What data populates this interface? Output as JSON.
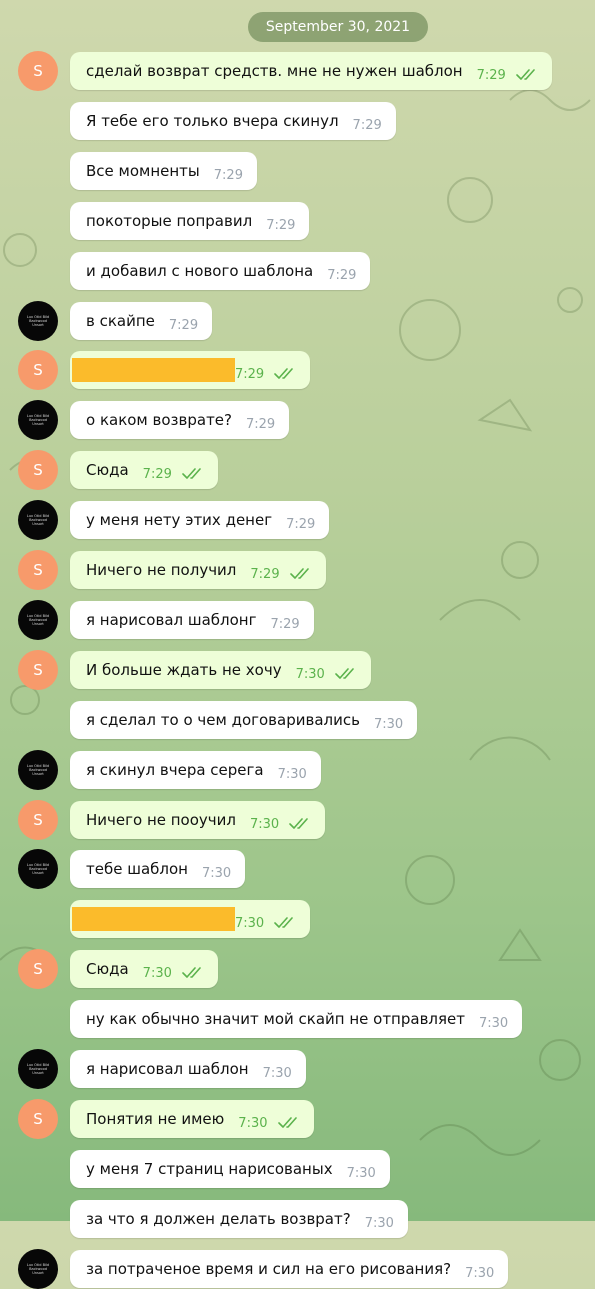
{
  "date_label": "September 30, 2021",
  "colors": {
    "accent_check": "#5bb24c",
    "out_bubble": "#eefed8",
    "in_bubble": "#ffffff",
    "avatar_s": "#f79a6b",
    "avatar_dark": "#070707",
    "highlight": "#fbbb2b"
  },
  "avatar_s_label": "S",
  "avatar_dark_label": "Lux Otid Bild Backwood Unsort",
  "messages": [
    {
      "dir": "out",
      "text": "сделай возврат средств. мне не нужен шаблон",
      "time": "7:29",
      "avatar": "s"
    },
    {
      "dir": "in",
      "text": "Я тебе его только вчера скинул",
      "time": "7:29",
      "avatar": ""
    },
    {
      "dir": "in",
      "text": "Все момненты",
      "time": "7:29",
      "avatar": ""
    },
    {
      "dir": "in",
      "text": "покоторые поправил",
      "time": "7:29",
      "avatar": ""
    },
    {
      "dir": "in",
      "text": "и добавил с нового шаблона",
      "time": "7:29",
      "avatar": ""
    },
    {
      "dir": "in",
      "text": "в скайпе",
      "time": "7:29",
      "avatar": "d"
    },
    {
      "dir": "out",
      "text": "",
      "time": "7:29",
      "avatar": "s",
      "highlight": true
    },
    {
      "dir": "in",
      "text": "о каком возврате?",
      "time": "7:29",
      "avatar": "d"
    },
    {
      "dir": "out",
      "text": "Сюда",
      "time": "7:29",
      "avatar": "s"
    },
    {
      "dir": "in",
      "text": "у меня нету этих денег",
      "time": "7:29",
      "avatar": "d"
    },
    {
      "dir": "out",
      "text": "Ничего не получил",
      "time": "7:29",
      "avatar": "s"
    },
    {
      "dir": "in",
      "text": "я нарисовал шаблонг",
      "time": "7:29",
      "avatar": "d"
    },
    {
      "dir": "out",
      "text": "И больше ждать не хочу",
      "time": "7:30",
      "avatar": "s"
    },
    {
      "dir": "in",
      "text": "я сделал то о чем договаривались",
      "time": "7:30",
      "avatar": ""
    },
    {
      "dir": "in",
      "text": "я скинул вчера серега",
      "time": "7:30",
      "avatar": "d"
    },
    {
      "dir": "out",
      "text": "Ничего не пооучил",
      "time": "7:30",
      "avatar": "s"
    },
    {
      "dir": "in",
      "text": "тебе шаблон",
      "time": "7:30",
      "avatar": "d"
    },
    {
      "dir": "out",
      "text": "",
      "time": "7:30",
      "avatar": "",
      "highlight": true
    },
    {
      "dir": "out",
      "text": "Сюда",
      "time": "7:30",
      "avatar": "s"
    },
    {
      "dir": "in",
      "text": "ну как обычно значит мой скайп не отправляет",
      "time": "7:30",
      "avatar": ""
    },
    {
      "dir": "in",
      "text": "я нарисовал шаблон",
      "time": "7:30",
      "avatar": "d"
    },
    {
      "dir": "out",
      "text": "Понятия не имею",
      "time": "7:30",
      "avatar": "s"
    },
    {
      "dir": "in",
      "text": "у меня 7 страниц нарисованых",
      "time": "7:30",
      "avatar": ""
    },
    {
      "dir": "in",
      "text": "за что я должен делать возврат?",
      "time": "7:30",
      "avatar": ""
    },
    {
      "dir": "in",
      "text": "за потраченое время и сил на его рисования?",
      "time": "7:30",
      "avatar": "d"
    }
  ]
}
